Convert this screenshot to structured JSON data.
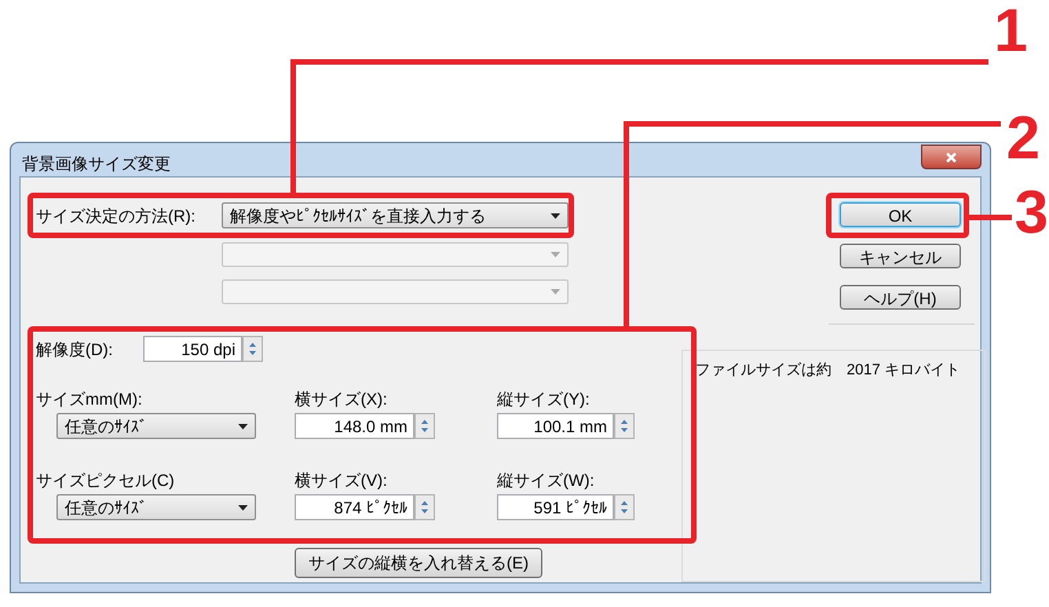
{
  "window": {
    "title": "背景画像サイズ変更"
  },
  "method": {
    "label": "サイズ決定の方法(R):",
    "value": "解像度やﾋﾟｸｾﾙｻｲｽﾞを直接入力する"
  },
  "extra_combos": [
    {
      "disabled": true
    },
    {
      "disabled": true
    }
  ],
  "resolution": {
    "label": "解像度(D):",
    "value": "150 dpi"
  },
  "size_rows": [
    {
      "label": "サイズmm(M):",
      "preset": "任意のｻｲｽﾞ",
      "width_label": "横サイズ(X):",
      "width": "148.0 mm",
      "height_label": "縦サイズ(Y):",
      "height": "100.1 mm"
    },
    {
      "label": "サイズピクセル(C)",
      "preset": "任意のｻｲｽﾞ",
      "width_label": "横サイズ(V):",
      "width": "874 ﾋﾟｸｾﾙ",
      "height_label": "縦サイズ(W):",
      "height": "591 ﾋﾟｸｾﾙ"
    }
  ],
  "swap_button": "サイズの縦横を入れ替える(E)",
  "buttons": [
    {
      "label": "OK",
      "focused": true
    },
    {
      "label": "キャンセル",
      "focused": false
    },
    {
      "label": "ヘルプ(H)",
      "focused": false
    }
  ],
  "file_size": "ファイルサイズは約　2017 キロバイト",
  "annotations": [
    {
      "number": "1"
    },
    {
      "number": "2"
    },
    {
      "number": "3"
    }
  ]
}
